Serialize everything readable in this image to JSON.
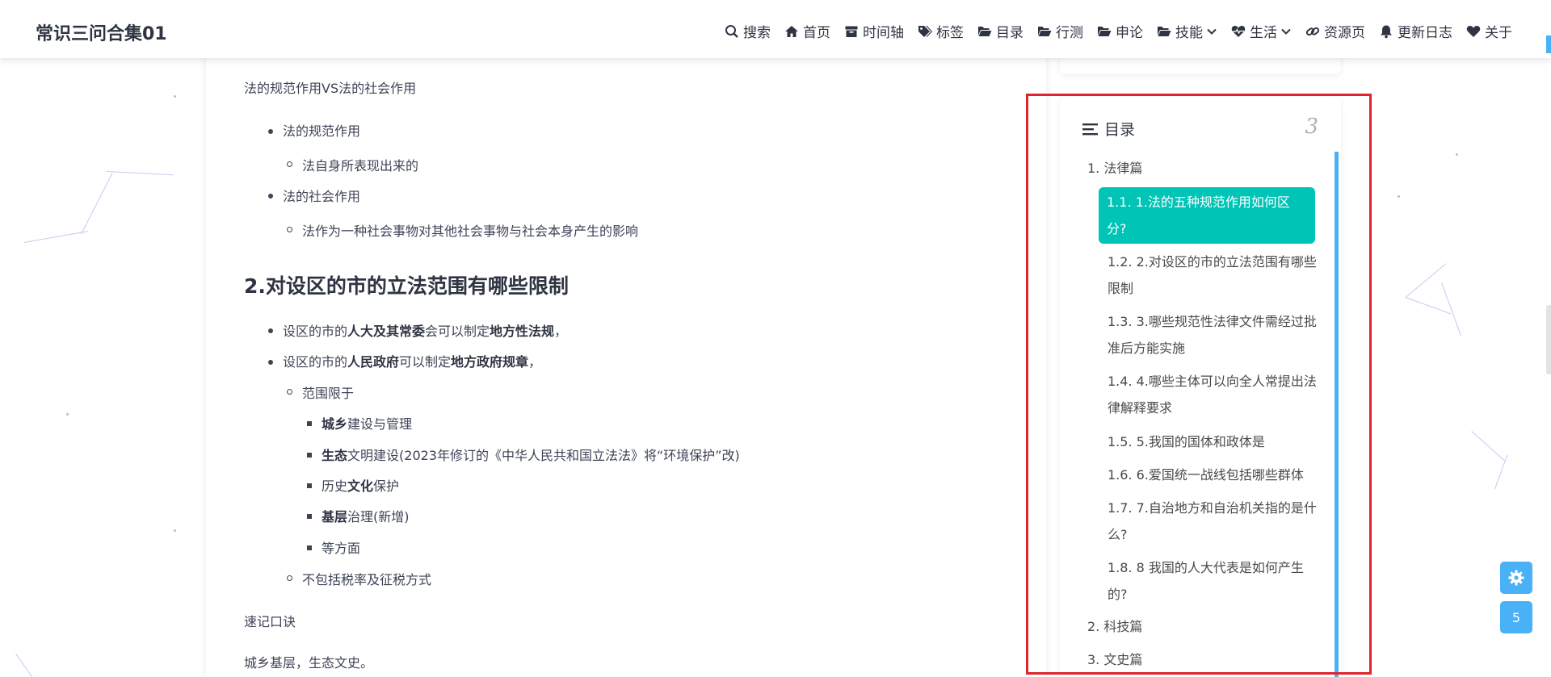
{
  "header": {
    "site_title": "常识三问合集01",
    "nav": [
      {
        "label": "搜索",
        "icon": "search-icon"
      },
      {
        "label": "首页",
        "icon": "home-icon"
      },
      {
        "label": "时间轴",
        "icon": "archive-icon"
      },
      {
        "label": "标签",
        "icon": "tags-icon"
      },
      {
        "label": "目录",
        "icon": "folder-open-icon"
      },
      {
        "label": "行测",
        "icon": "folder-open-icon"
      },
      {
        "label": "申论",
        "icon": "folder-open-icon"
      },
      {
        "label": "技能",
        "icon": "folder-open-icon",
        "dropdown": true
      },
      {
        "label": "生活",
        "icon": "heartbeat-icon",
        "dropdown": true
      },
      {
        "label": "资源页",
        "icon": "link-icon"
      },
      {
        "label": "更新日志",
        "icon": "bell-icon"
      },
      {
        "label": "关于",
        "icon": "heart-icon"
      }
    ]
  },
  "article": {
    "intro_line": "法的规范作用VS法的社会作用",
    "list1": [
      {
        "text": "法的规范作用",
        "sub": "法自身所表现出来的"
      },
      {
        "text": "法的社会作用",
        "sub": "法作为一种社会事物对其他社会事物与社会本身产生的影响"
      }
    ],
    "heading2": "2.对设区的市的立法范围有哪些限制",
    "list2": [
      {
        "pre": "设区的市的",
        "b1": "人大及其常委",
        "mid": "会可以制定",
        "b2": "地方性法规",
        "post": "，"
      },
      {
        "pre": "设区的市的",
        "b1": "人民政府",
        "mid": "可以制定",
        "b2": "地方政府规章",
        "post": "，"
      }
    ],
    "scope_label": "范围限于",
    "scope_items": [
      {
        "b": "城乡",
        "text": "建设与管理"
      },
      {
        "b": "生态",
        "text": "文明建设(2023年修订的《中华人民共和国立法法》将“环境保护”改)"
      },
      {
        "pre": "历史",
        "b": "文化",
        "text": "保护"
      },
      {
        "b": "基层",
        "text": "治理(新增)"
      },
      {
        "b": "",
        "text": "等方面"
      }
    ],
    "exclude_label": "不包括税率及征税方式",
    "mnemonic_title": "速记口诀",
    "mnemonic_text": "城乡基层，生态文史。"
  },
  "toc": {
    "title": "目录",
    "percent": "3",
    "items": [
      {
        "level": 1,
        "text": "1. 法律篇"
      },
      {
        "level": 2,
        "text": "1.1. 1.法的五种规范作用如何区分?",
        "active": true
      },
      {
        "level": 2,
        "text": "1.2. 2.对设区的市的立法范围有哪些限制"
      },
      {
        "level": 2,
        "text": "1.3. 3.哪些规范性法律文件需经过批准后方能实施"
      },
      {
        "level": 2,
        "text": "1.4. 4.哪些主体可以向全人常提出法律解释要求"
      },
      {
        "level": 2,
        "text": "1.5. 5.我国的国体和政体是"
      },
      {
        "level": 2,
        "text": "1.6. 6.爱国统一战线包括哪些群体"
      },
      {
        "level": 2,
        "text": "1.7. 7.自治地方和自治机关指的是什么?"
      },
      {
        "level": 2,
        "text": "1.8. 8 我国的人大代表是如何产生的?"
      },
      {
        "level": 1,
        "text": "2. 科技篇"
      },
      {
        "level": 1,
        "text": "3. 文史篇"
      }
    ]
  },
  "float_buttons": {
    "settings_icon": "gear-icon",
    "counter": "5"
  },
  "colors": {
    "accent": "#49b1f5",
    "toc_active": "#00c4b6",
    "highlight_border": "#e0242b"
  }
}
